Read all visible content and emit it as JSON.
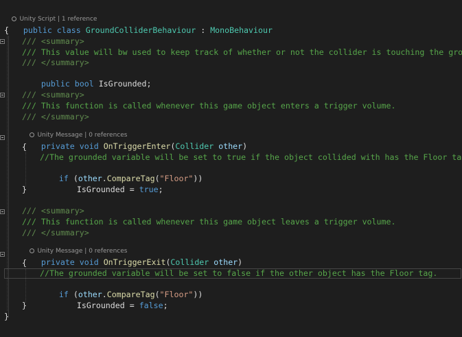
{
  "codelens": {
    "class_lens": {
      "kind": "Unity Script",
      "separator": "|",
      "refs": "1 reference"
    },
    "enter_lens": {
      "kind": "Unity Message",
      "separator": "|",
      "refs": "0 references"
    },
    "exit_lens": {
      "kind": "Unity Message",
      "separator": "|",
      "refs": "0 references"
    }
  },
  "code": {
    "class_line": {
      "kw1": "public",
      "kw2": "class",
      "class_name": "GroundColliderBehaviour",
      "colon": " : ",
      "base_class": "MonoBehaviour"
    },
    "open_brace": "{",
    "close_brace": "}",
    "field_summary_open": "/// <summary>",
    "field_summary_text": "/// This value will bw used to keep track of whether or not the collider is touching the ground.",
    "field_summary_close": "/// </summary>",
    "field_decl": {
      "kw1": "public",
      "kw2": "bool",
      "name": "IsGrounded;"
    },
    "enter_summary_open": "/// <summary>",
    "enter_summary_text": "/// This function is called whenever this game object enters a trigger volume.",
    "enter_summary_close": "/// </summary>",
    "enter_sig": {
      "kw1": "private",
      "kw2": "void",
      "method": "OnTriggerEnter",
      "open_paren": "(",
      "param_type": "Collider",
      "param_name": "other",
      "close_paren": ")"
    },
    "enter_open_brace": "{",
    "enter_comment": "//The grounded variable will be set to true if the object collided with has the Floor tag.",
    "enter_if": {
      "kw": "if",
      "open": " (",
      "obj": "other",
      "dot": ".",
      "method": "CompareTag",
      "paren_open": "(",
      "str": "\"Floor\"",
      "paren_close": "))"
    },
    "enter_assign": {
      "var": "IsGrounded",
      "op": " = ",
      "value": "true",
      "semi": ";"
    },
    "enter_close_brace": "}",
    "exit_summary_open": "/// <summary>",
    "exit_summary_text": "/// This function is called whenever this game object leaves a trigger volume.",
    "exit_summary_close": "/// </summary>",
    "exit_sig": {
      "kw1": "private",
      "kw2": "void",
      "method": "OnTriggerExit",
      "open_paren": "(",
      "param_type": "Collider",
      "param_name": "other",
      "close_paren": ")"
    },
    "exit_open_brace": "{",
    "exit_comment": "//The grounded variable will be set to false if the other object has the Floor tag.",
    "exit_if": {
      "kw": "if",
      "open": " (",
      "obj": "other",
      "dot": ".",
      "method": "CompareTag",
      "paren_open": "(",
      "str": "\"Floor\"",
      "paren_close": "))"
    },
    "exit_assign": {
      "var": "IsGrounded",
      "op": " = ",
      "value": "false",
      "semi": ";"
    },
    "exit_close_brace": "}"
  },
  "theme": {
    "background": "#1e1e1e",
    "keyword": "#569cd6",
    "type": "#4ec9b0",
    "method": "#dcdcaa",
    "parameter": "#9cdcfe",
    "string": "#d69d85",
    "comment": "#57a64a",
    "text": "#dcdcdc"
  }
}
